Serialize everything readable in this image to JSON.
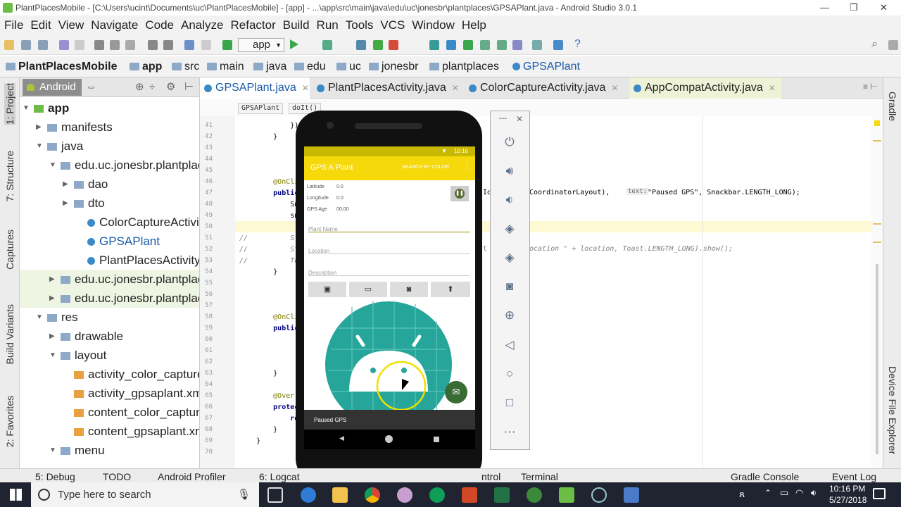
{
  "window": {
    "title": "PlantPlacesMobile - [C:\\Users\\ucint\\Documents\\uc\\PlantPlacesMobile] - [app] - ...\\app\\src\\main\\java\\edu\\uc\\jonesbr\\plantplaces\\GPSAPlant.java - Android Studio 3.0.1",
    "minimize": "—",
    "maximize": "❐",
    "close": "✕"
  },
  "menu": [
    "File",
    "Edit",
    "View",
    "Navigate",
    "Code",
    "Analyze",
    "Refactor",
    "Build",
    "Run",
    "Tools",
    "VCS",
    "Window",
    "Help"
  ],
  "toolbar": {
    "run_config": "app"
  },
  "breadcrumb": [
    "PlantPlacesMobile",
    "app",
    "src",
    "main",
    "java",
    "edu",
    "uc",
    "jonesbr",
    "plantplaces",
    "GPSAPlant"
  ],
  "left_strip": [
    "1: Project",
    "7: Structure",
    "Captures",
    "Build Variants",
    "2: Favorites"
  ],
  "right_strip": [
    "Gradle",
    "Device File Explorer"
  ],
  "project_panel": {
    "view": "Android",
    "tree": [
      {
        "label": "app",
        "bold": true,
        "depth": 0,
        "arrow": "▼",
        "icon": "module"
      },
      {
        "label": "manifests",
        "depth": 1,
        "arrow": "▶",
        "icon": "folder"
      },
      {
        "label": "java",
        "depth": 1,
        "arrow": "▼",
        "icon": "folder"
      },
      {
        "label": "edu.uc.jonesbr.plantplac",
        "depth": 2,
        "arrow": "▼",
        "icon": "package"
      },
      {
        "label": "dao",
        "depth": 3,
        "arrow": "▶",
        "icon": "package"
      },
      {
        "label": "dto",
        "depth": 3,
        "arrow": "▶",
        "icon": "package"
      },
      {
        "label": "ColorCaptureActivity",
        "depth": 4,
        "arrow": "",
        "icon": "class"
      },
      {
        "label": "GPSAPlant",
        "depth": 4,
        "arrow": "",
        "icon": "class",
        "selected": true
      },
      {
        "label": "PlantPlacesActivity",
        "depth": 4,
        "arrow": "",
        "icon": "class"
      },
      {
        "label": "edu.uc.jonesbr.plantplac",
        "depth": 2,
        "arrow": "▶",
        "icon": "package",
        "shaded": true
      },
      {
        "label": "edu.uc.jonesbr.plantplac",
        "depth": 2,
        "arrow": "▶",
        "icon": "package",
        "shaded": true
      },
      {
        "label": "res",
        "depth": 1,
        "arrow": "▼",
        "icon": "folder"
      },
      {
        "label": "drawable",
        "depth": 2,
        "arrow": "▶",
        "icon": "folder"
      },
      {
        "label": "layout",
        "depth": 2,
        "arrow": "▼",
        "icon": "folder"
      },
      {
        "label": "activity_color_capture.",
        "depth": 3,
        "arrow": "",
        "icon": "xml"
      },
      {
        "label": "activity_gpsaplant.xml",
        "depth": 3,
        "arrow": "",
        "icon": "xml"
      },
      {
        "label": "content_color_capture",
        "depth": 3,
        "arrow": "",
        "icon": "xml"
      },
      {
        "label": "content_gpsaplant.xm",
        "depth": 3,
        "arrow": "",
        "icon": "xml"
      },
      {
        "label": "menu",
        "depth": 2,
        "arrow": "▼",
        "icon": "folder"
      }
    ]
  },
  "editor_tabs": [
    {
      "label": "GPSAPlant.java",
      "active": true
    },
    {
      "label": "PlantPlacesActivity.java"
    },
    {
      "label": "ColorCaptureActivity.java"
    },
    {
      "label": "AppCompatActivity.java"
    }
  ],
  "editor_breadcrumb": [
    "GPSAPlant",
    "doIt()"
  ],
  "line_numbers": [
    "41",
    "42",
    "43",
    "44",
    "45",
    "46",
    "47",
    "48",
    "49",
    "50",
    "51",
    "52",
    "53",
    "54",
    "55",
    "56",
    "57",
    "58",
    "59",
    "60",
    "61",
    "62",
    "63",
    "64",
    "65",
    "66",
    "67",
    "68",
    "69",
    "70"
  ],
  "code_lines": [
    {
      "line": 41,
      "text": "            });"
    },
    {
      "line": 42,
      "text": "        }"
    },
    {
      "line": 46,
      "text": "        @OnClick"
    },
    {
      "line": 47,
      "text": "        public v"
    },
    {
      "line": 48,
      "text": "            Snac"
    },
    {
      "line": 49,
      "text": "            snac"
    },
    {
      "line": 51,
      "text": "//          St"
    },
    {
      "line": 52,
      "text": "//          St"
    },
    {
      "line": 53,
      "text": "//          To"
    },
    {
      "line": 54,
      "text": "        }"
    },
    {
      "line": 58,
      "text": "        @OnClick"
    },
    {
      "line": 59,
      "text": "        public v"
    },
    {
      "line": 63,
      "text": "        }"
    },
    {
      "line": 65,
      "text": "        @Overrid"
    },
    {
      "line": 66,
      "text": "        protecte"
    },
    {
      "line": 67,
      "text": "            retu"
    },
    {
      "line": 68,
      "text": "        }"
    },
    {
      "line": 69,
      "text": "    }"
    }
  ],
  "code_right": {
    "line48": "CoordinatorLayout),",
    "line48_hint": "text:",
    "line48_rest": "\"Paused GPS\", Snackbar.LENGTH_LONG);",
    "line48_prefix": "Id",
    "line53": "ocation \" + location, Toast.LENGTH_LONG).show();",
    "line53_prefix": "t"
  },
  "phone": {
    "status_time": "10:16",
    "app_title": "GPS A Plant",
    "action": "SEARCH BY COLOR",
    "latitude_label": "Latitude",
    "latitude_value": "0.0",
    "longitude_label": "Longitude",
    "longitude_value": "0.0",
    "gps_age_label": "GPS Age",
    "gps_age_value": "00:00",
    "plant_name_hint": "Plant Name",
    "location_hint": "Location",
    "description_hint": "Description",
    "snackbar": "Paused GPS",
    "accent": "#f5d90a",
    "fab_color": "#3a6b35"
  },
  "bottom_tools": [
    "5: Debug",
    "TODO",
    "Android Profiler",
    "6: Logcat",
    "ntrol",
    "Terminal",
    "Gradle Console",
    "Event Log"
  ],
  "taskbar": {
    "search_placeholder": "Type here to search",
    "time": "10:16 PM",
    "date": "5/27/2018"
  }
}
